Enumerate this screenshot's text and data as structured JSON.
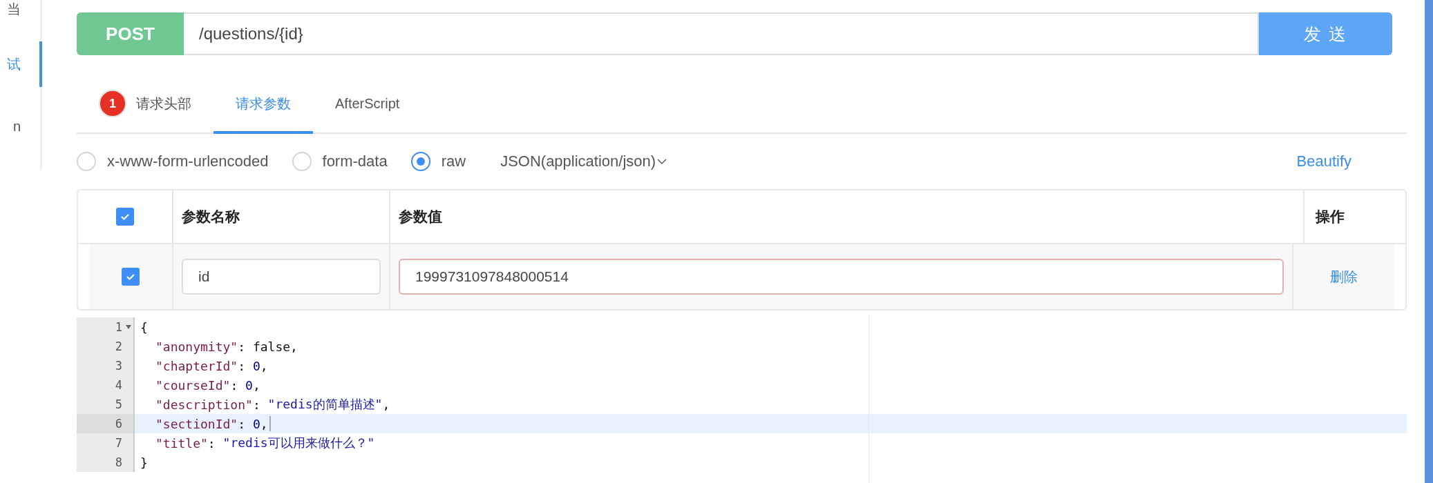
{
  "sidebar": {
    "items": [
      {
        "label": "当",
        "selected": false
      },
      {
        "label": "试",
        "selected": true
      },
      {
        "label": "n",
        "selected": false
      }
    ]
  },
  "request": {
    "method": "POST",
    "url": "/questions/{id}",
    "send": "发 送"
  },
  "tabs": [
    {
      "label": "请求头部",
      "badge": "1",
      "selected": false
    },
    {
      "label": "请求参数",
      "selected": true
    },
    {
      "label": "AfterScript",
      "selected": false
    }
  ],
  "body_types": [
    {
      "label": "x-www-form-urlencoded",
      "selected": false
    },
    {
      "label": "form-data",
      "selected": false
    },
    {
      "label": "raw",
      "selected": true
    }
  ],
  "content_type": "JSON(application/json)",
  "beautify": "Beautify",
  "params_table": {
    "header_checked": true,
    "columns": [
      "参数名称",
      "参数值",
      "操作"
    ],
    "rows": [
      {
        "checked": true,
        "name": "id",
        "value": "1999731097848000514",
        "invalid": true,
        "action": "删除"
      }
    ]
  },
  "editor": {
    "lines": [
      {
        "number": "1",
        "foldable": true,
        "active": false,
        "tokens": [
          {
            "kind": "punct",
            "text": "{"
          }
        ]
      },
      {
        "number": "2",
        "foldable": false,
        "active": false,
        "tokens": [
          {
            "kind": "key",
            "text": "\"anonymity\""
          },
          {
            "kind": "punct",
            "text": ": "
          },
          {
            "kind": "boolean",
            "text": "false"
          },
          {
            "kind": "punct",
            "text": ","
          }
        ]
      },
      {
        "number": "3",
        "foldable": false,
        "active": false,
        "tokens": [
          {
            "kind": "key",
            "text": "\"chapterId\""
          },
          {
            "kind": "punct",
            "text": ": "
          },
          {
            "kind": "number",
            "text": "0"
          },
          {
            "kind": "punct",
            "text": ","
          }
        ]
      },
      {
        "number": "4",
        "foldable": false,
        "active": false,
        "tokens": [
          {
            "kind": "key",
            "text": "\"courseId\""
          },
          {
            "kind": "punct",
            "text": ": "
          },
          {
            "kind": "number",
            "text": "0"
          },
          {
            "kind": "punct",
            "text": ","
          }
        ]
      },
      {
        "number": "5",
        "foldable": false,
        "active": false,
        "tokens": [
          {
            "kind": "key",
            "text": "\"description\""
          },
          {
            "kind": "punct",
            "text": ": "
          },
          {
            "kind": "string",
            "text": "\"redis的简单描述\""
          },
          {
            "kind": "punct",
            "text": ","
          }
        ]
      },
      {
        "number": "6",
        "foldable": false,
        "active": true,
        "tokens": [
          {
            "kind": "key",
            "text": "\"sectionId\""
          },
          {
            "kind": "punct",
            "text": ": "
          },
          {
            "kind": "number",
            "text": "0"
          },
          {
            "kind": "punct",
            "text": ","
          }
        ]
      },
      {
        "number": "7",
        "foldable": false,
        "active": false,
        "tokens": [
          {
            "kind": "key",
            "text": "\"title\""
          },
          {
            "kind": "punct",
            "text": ": "
          },
          {
            "kind": "string",
            "text": "\"redis可以用来做什么？\""
          }
        ]
      },
      {
        "number": "8",
        "foldable": false,
        "active": false,
        "tokens": [
          {
            "kind": "punct",
            "text": "}"
          }
        ]
      }
    ]
  }
}
